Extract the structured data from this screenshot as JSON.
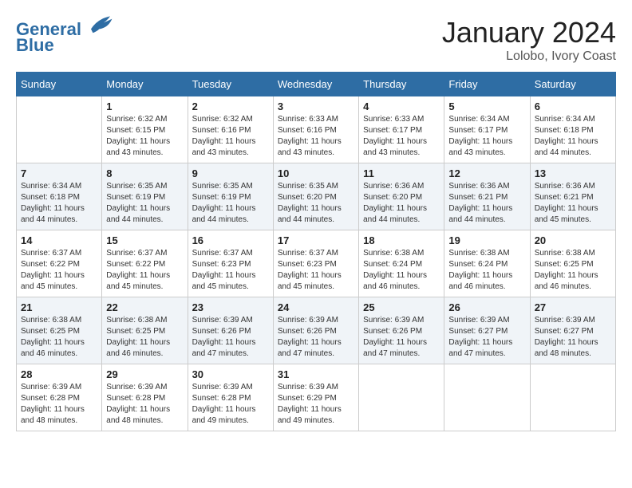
{
  "header": {
    "logo_line1": "General",
    "logo_line2": "Blue",
    "month_year": "January 2024",
    "location": "Lolobo, Ivory Coast"
  },
  "columns": [
    "Sunday",
    "Monday",
    "Tuesday",
    "Wednesday",
    "Thursday",
    "Friday",
    "Saturday"
  ],
  "weeks": [
    [
      {
        "day": "",
        "info": ""
      },
      {
        "day": "1",
        "info": "Sunrise: 6:32 AM\nSunset: 6:15 PM\nDaylight: 11 hours\nand 43 minutes."
      },
      {
        "day": "2",
        "info": "Sunrise: 6:32 AM\nSunset: 6:16 PM\nDaylight: 11 hours\nand 43 minutes."
      },
      {
        "day": "3",
        "info": "Sunrise: 6:33 AM\nSunset: 6:16 PM\nDaylight: 11 hours\nand 43 minutes."
      },
      {
        "day": "4",
        "info": "Sunrise: 6:33 AM\nSunset: 6:17 PM\nDaylight: 11 hours\nand 43 minutes."
      },
      {
        "day": "5",
        "info": "Sunrise: 6:34 AM\nSunset: 6:17 PM\nDaylight: 11 hours\nand 43 minutes."
      },
      {
        "day": "6",
        "info": "Sunrise: 6:34 AM\nSunset: 6:18 PM\nDaylight: 11 hours\nand 44 minutes."
      }
    ],
    [
      {
        "day": "7",
        "info": "Sunrise: 6:34 AM\nSunset: 6:18 PM\nDaylight: 11 hours\nand 44 minutes."
      },
      {
        "day": "8",
        "info": "Sunrise: 6:35 AM\nSunset: 6:19 PM\nDaylight: 11 hours\nand 44 minutes."
      },
      {
        "day": "9",
        "info": "Sunrise: 6:35 AM\nSunset: 6:19 PM\nDaylight: 11 hours\nand 44 minutes."
      },
      {
        "day": "10",
        "info": "Sunrise: 6:35 AM\nSunset: 6:20 PM\nDaylight: 11 hours\nand 44 minutes."
      },
      {
        "day": "11",
        "info": "Sunrise: 6:36 AM\nSunset: 6:20 PM\nDaylight: 11 hours\nand 44 minutes."
      },
      {
        "day": "12",
        "info": "Sunrise: 6:36 AM\nSunset: 6:21 PM\nDaylight: 11 hours\nand 44 minutes."
      },
      {
        "day": "13",
        "info": "Sunrise: 6:36 AM\nSunset: 6:21 PM\nDaylight: 11 hours\nand 45 minutes."
      }
    ],
    [
      {
        "day": "14",
        "info": "Sunrise: 6:37 AM\nSunset: 6:22 PM\nDaylight: 11 hours\nand 45 minutes."
      },
      {
        "day": "15",
        "info": "Sunrise: 6:37 AM\nSunset: 6:22 PM\nDaylight: 11 hours\nand 45 minutes."
      },
      {
        "day": "16",
        "info": "Sunrise: 6:37 AM\nSunset: 6:23 PM\nDaylight: 11 hours\nand 45 minutes."
      },
      {
        "day": "17",
        "info": "Sunrise: 6:37 AM\nSunset: 6:23 PM\nDaylight: 11 hours\nand 45 minutes."
      },
      {
        "day": "18",
        "info": "Sunrise: 6:38 AM\nSunset: 6:24 PM\nDaylight: 11 hours\nand 46 minutes."
      },
      {
        "day": "19",
        "info": "Sunrise: 6:38 AM\nSunset: 6:24 PM\nDaylight: 11 hours\nand 46 minutes."
      },
      {
        "day": "20",
        "info": "Sunrise: 6:38 AM\nSunset: 6:25 PM\nDaylight: 11 hours\nand 46 minutes."
      }
    ],
    [
      {
        "day": "21",
        "info": "Sunrise: 6:38 AM\nSunset: 6:25 PM\nDaylight: 11 hours\nand 46 minutes."
      },
      {
        "day": "22",
        "info": "Sunrise: 6:38 AM\nSunset: 6:25 PM\nDaylight: 11 hours\nand 46 minutes."
      },
      {
        "day": "23",
        "info": "Sunrise: 6:39 AM\nSunset: 6:26 PM\nDaylight: 11 hours\nand 47 minutes."
      },
      {
        "day": "24",
        "info": "Sunrise: 6:39 AM\nSunset: 6:26 PM\nDaylight: 11 hours\nand 47 minutes."
      },
      {
        "day": "25",
        "info": "Sunrise: 6:39 AM\nSunset: 6:26 PM\nDaylight: 11 hours\nand 47 minutes."
      },
      {
        "day": "26",
        "info": "Sunrise: 6:39 AM\nSunset: 6:27 PM\nDaylight: 11 hours\nand 47 minutes."
      },
      {
        "day": "27",
        "info": "Sunrise: 6:39 AM\nSunset: 6:27 PM\nDaylight: 11 hours\nand 48 minutes."
      }
    ],
    [
      {
        "day": "28",
        "info": "Sunrise: 6:39 AM\nSunset: 6:28 PM\nDaylight: 11 hours\nand 48 minutes."
      },
      {
        "day": "29",
        "info": "Sunrise: 6:39 AM\nSunset: 6:28 PM\nDaylight: 11 hours\nand 48 minutes."
      },
      {
        "day": "30",
        "info": "Sunrise: 6:39 AM\nSunset: 6:28 PM\nDaylight: 11 hours\nand 49 minutes."
      },
      {
        "day": "31",
        "info": "Sunrise: 6:39 AM\nSunset: 6:29 PM\nDaylight: 11 hours\nand 49 minutes."
      },
      {
        "day": "",
        "info": ""
      },
      {
        "day": "",
        "info": ""
      },
      {
        "day": "",
        "info": ""
      }
    ]
  ]
}
